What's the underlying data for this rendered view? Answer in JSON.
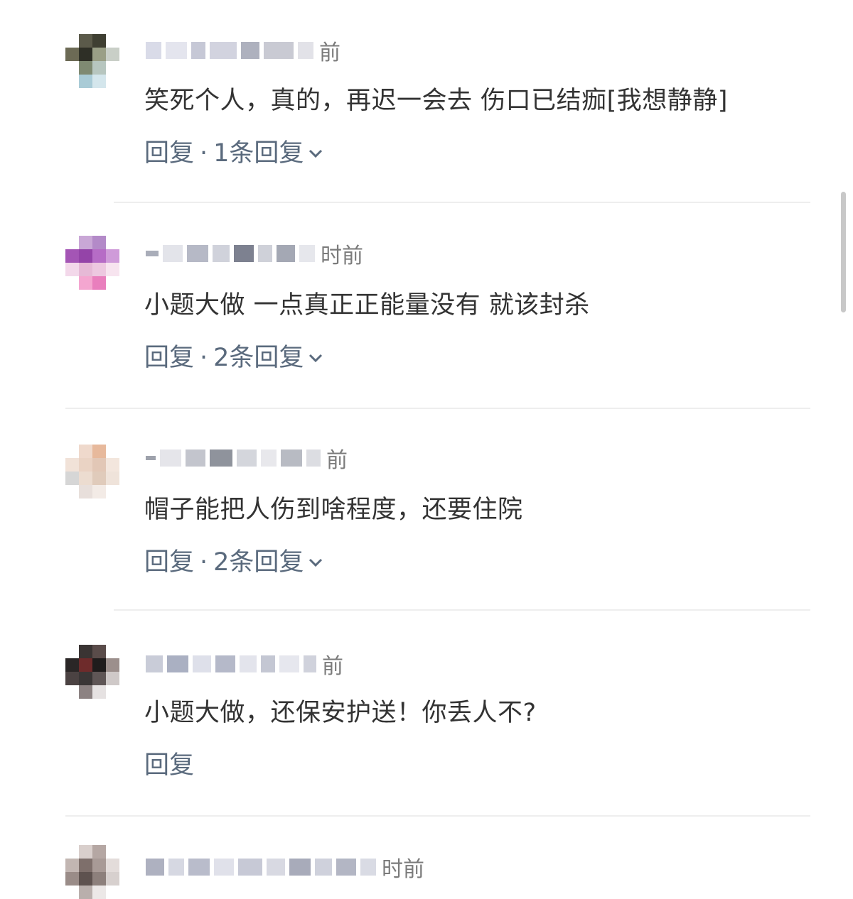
{
  "comments": [
    {
      "time_suffix": "前",
      "text": "笑死个人，真的，再迟一会去 伤口已结痂[我想静静]",
      "reply_label": "回复",
      "sep": "·",
      "reply_count": "1条回复"
    },
    {
      "time_suffix": "时前",
      "text": "小题大做 一点真正正能量没有 就该封杀",
      "reply_label": "回复",
      "sep": "·",
      "reply_count": "2条回复"
    },
    {
      "time_suffix": "前",
      "text": "帽子能把人伤到啥程度，还要住院",
      "reply_label": "回复",
      "sep": "·",
      "reply_count": "2条回复"
    },
    {
      "time_suffix": "前",
      "text": "小题大做，还保安护送！你丢人不?",
      "reply_label": "回复"
    },
    {
      "time_suffix": "时前"
    }
  ],
  "icons": {
    "expand": "chevron-down-icon"
  },
  "colors": {
    "text": "#333333",
    "muted": "#7b7b7b",
    "action": "#5a6a7d",
    "divider": "#eeeeee"
  }
}
